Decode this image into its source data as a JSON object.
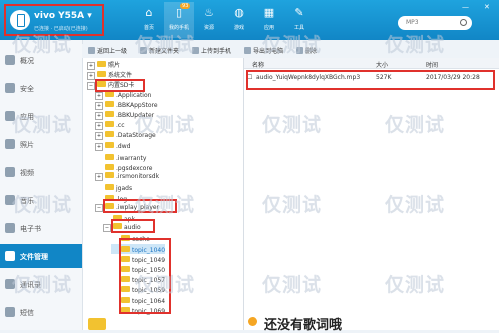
{
  "device": {
    "name": "vivo Y55A",
    "status": "已连接 · 已启动(已连接)"
  },
  "topnav": [
    {
      "label": "首页",
      "icon": "home-icon",
      "glyph": "⌂"
    },
    {
      "label": "我的手机",
      "icon": "phone-icon",
      "glyph": "▯",
      "badge": "93",
      "active": true
    },
    {
      "label": "资源",
      "icon": "flame-icon",
      "glyph": "♨"
    },
    {
      "label": "游戏",
      "icon": "gamepad-icon",
      "glyph": "◍"
    },
    {
      "label": "应用",
      "icon": "grid-icon",
      "glyph": "▦"
    },
    {
      "label": "工具",
      "icon": "wrench-icon",
      "glyph": "✎"
    }
  ],
  "search": {
    "placeholder": "MP3"
  },
  "window": {
    "minimize": "—",
    "close": "✕"
  },
  "sidebar": [
    {
      "label": "概况",
      "icon": "overview-icon"
    },
    {
      "label": "安全",
      "icon": "shield-icon"
    },
    {
      "label": "应用",
      "icon": "apps-icon"
    },
    {
      "label": "照片",
      "icon": "photo-icon"
    },
    {
      "label": "视频",
      "icon": "video-icon"
    },
    {
      "label": "音乐",
      "icon": "music-icon"
    },
    {
      "label": "电子书",
      "icon": "book-icon"
    },
    {
      "label": "文件管理",
      "icon": "folder-icon",
      "active": true
    },
    {
      "label": "通讯录",
      "icon": "contacts-icon"
    },
    {
      "label": "短信",
      "icon": "sms-icon"
    }
  ],
  "toolbar": {
    "up": "返回上一级",
    "new_folder": "新建文件夹",
    "upload": "上传到手机",
    "export": "导出到电脑",
    "delete": "删除"
  },
  "tree": [
    {
      "label": "照片",
      "toggle": "+",
      "indent": 0
    },
    {
      "label": "系统文件",
      "toggle": "+",
      "indent": 0
    },
    {
      "label": "内置SD卡",
      "toggle": "−",
      "indent": 0
    },
    {
      "label": ".Application",
      "toggle": "+",
      "indent": 1
    },
    {
      "label": ".BBKAppStore",
      "toggle": "+",
      "indent": 1
    },
    {
      "label": ".BBKUpdater",
      "toggle": "+",
      "indent": 1
    },
    {
      "label": ".cc",
      "toggle": "+",
      "indent": 1
    },
    {
      "label": ".DataStorage",
      "toggle": "+",
      "indent": 1
    },
    {
      "label": ".dwd",
      "toggle": "+",
      "indent": 1
    },
    {
      "label": ".iwarranty",
      "toggle": "",
      "indent": 1
    },
    {
      "label": ".pgsdexcore",
      "toggle": "",
      "indent": 1
    },
    {
      "label": ".irsmonitorsdk",
      "toggle": "+",
      "indent": 1
    },
    {
      "label": "jgads",
      "toggle": "",
      "indent": 1
    },
    {
      "label": ".log",
      "toggle": "",
      "indent": 1
    },
    {
      "label": ".iwplay_player",
      "toggle": "−",
      "indent": 1
    },
    {
      "label": "apk",
      "toggle": "",
      "indent": 2
    },
    {
      "label": "audio",
      "toggle": "−",
      "indent": 2
    },
    {
      "label": "cache",
      "toggle": "",
      "indent": 3
    },
    {
      "label": "topic_1040",
      "toggle": "",
      "indent": 3,
      "selected": true
    },
    {
      "label": "topic_1049",
      "toggle": "",
      "indent": 3
    },
    {
      "label": "topic_1050",
      "toggle": "",
      "indent": 3
    },
    {
      "label": "topic_1057",
      "toggle": "",
      "indent": 3
    },
    {
      "label": "topic_1059",
      "toggle": "",
      "indent": 3
    },
    {
      "label": "topic_1064",
      "toggle": "",
      "indent": 3
    },
    {
      "label": "topic_1069",
      "toggle": "",
      "indent": 3
    }
  ],
  "files": {
    "headers": [
      "名称",
      "大小",
      "时间"
    ],
    "rows": [
      {
        "name": "audio_YuiqWepnk8dylqXBGch.mp3",
        "size": "527K",
        "time": "2017/03/29 20:28"
      }
    ]
  },
  "watermark": "仅测试",
  "banner": "还没有歌词哦"
}
